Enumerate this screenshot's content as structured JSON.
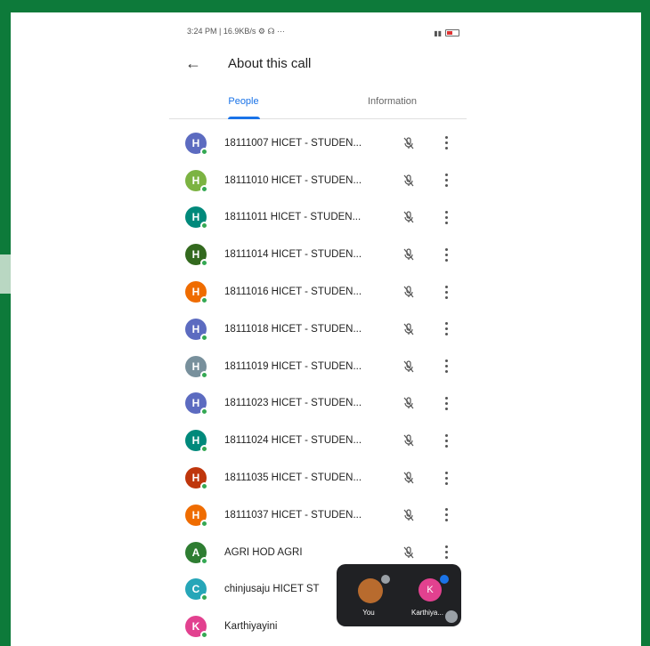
{
  "status_bar": {
    "text": "3:24 PM | 16.9KB/s ⚙ ☊ ···"
  },
  "header": {
    "title": "About this call"
  },
  "tabs": [
    {
      "label": "People",
      "active": true
    },
    {
      "label": "Information",
      "active": false
    }
  ],
  "participants": [
    {
      "initial": "H",
      "name": "18111007 HICET - STUDEN...",
      "color": "#5c6bc0"
    },
    {
      "initial": "H",
      "name": "18111010 HICET - STUDEN...",
      "color": "#7cb342"
    },
    {
      "initial": "H",
      "name": "18111011 HICET - STUDEN...",
      "color": "#00897b"
    },
    {
      "initial": "H",
      "name": "18111014 HICET - STUDEN...",
      "color": "#33691e"
    },
    {
      "initial": "H",
      "name": "18111016 HICET - STUDEN...",
      "color": "#ef6c00"
    },
    {
      "initial": "H",
      "name": "18111018 HICET - STUDEN...",
      "color": "#5c6bc0"
    },
    {
      "initial": "H",
      "name": "18111019 HICET - STUDEN...",
      "color": "#78909c"
    },
    {
      "initial": "H",
      "name": "18111023 HICET - STUDEN...",
      "color": "#5c6bc0"
    },
    {
      "initial": "H",
      "name": "18111024 HICET - STUDEN...",
      "color": "#00897b"
    },
    {
      "initial": "H",
      "name": "18111035 HICET - STUDEN...",
      "color": "#bf360c"
    },
    {
      "initial": "H",
      "name": "18111037 HICET - STUDEN...",
      "color": "#ef6c00"
    },
    {
      "initial": "A",
      "name": "AGRI HOD AGRI",
      "color": "#2e7d32"
    },
    {
      "initial": "C",
      "name": "chinjusaju HICET ST",
      "color": "#26a6b8"
    },
    {
      "initial": "K",
      "name": "Karthiyayini",
      "color": "#e2418f"
    }
  ],
  "pip": {
    "you_label": "You",
    "other_initial": "K",
    "other_label": "Karthiya..."
  }
}
